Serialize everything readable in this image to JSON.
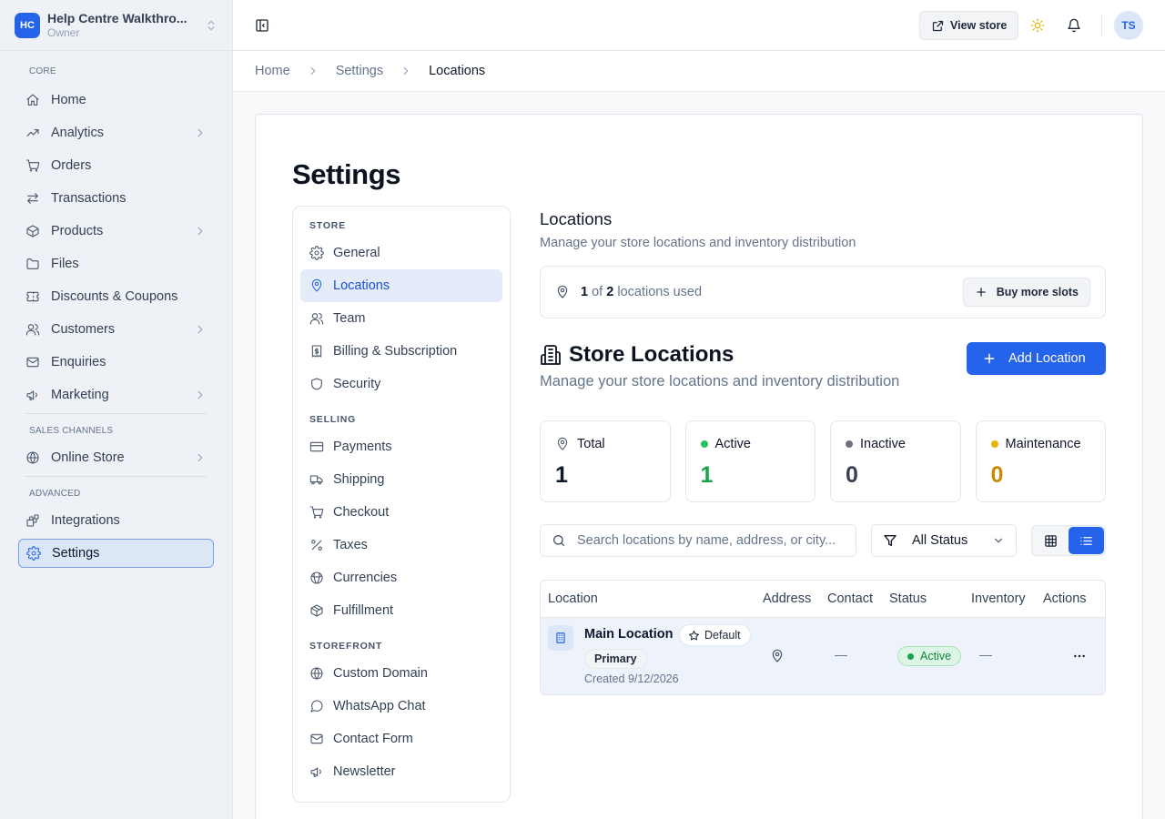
{
  "workspace": {
    "initials": "HC",
    "name": "Help Centre Walkthro...",
    "role": "Owner"
  },
  "sidebar": {
    "sections": [
      {
        "heading": "CORE",
        "items": [
          {
            "label": "Home",
            "icon": "home-icon",
            "chevron": false
          },
          {
            "label": "Analytics",
            "icon": "trending-up-icon",
            "chevron": true
          },
          {
            "label": "Orders",
            "icon": "cart-icon",
            "chevron": false
          },
          {
            "label": "Transactions",
            "icon": "arrows-exchange-icon",
            "chevron": false
          },
          {
            "label": "Products",
            "icon": "box-icon",
            "chevron": true
          },
          {
            "label": "Files",
            "icon": "folder-icon",
            "chevron": false
          },
          {
            "label": "Discounts & Coupons",
            "icon": "ticket-icon",
            "chevron": false
          },
          {
            "label": "Customers",
            "icon": "users-icon",
            "chevron": true
          },
          {
            "label": "Enquiries",
            "icon": "mail-icon",
            "chevron": false
          },
          {
            "label": "Marketing",
            "icon": "megaphone-icon",
            "chevron": true
          }
        ]
      },
      {
        "heading": "SALES CHANNELS",
        "items": [
          {
            "label": "Online Store",
            "icon": "globe-icon",
            "chevron": true
          }
        ]
      },
      {
        "heading": "ADVANCED",
        "items": [
          {
            "label": "Integrations",
            "icon": "blocks-icon",
            "chevron": false
          },
          {
            "label": "Settings",
            "icon": "gear-icon",
            "chevron": false,
            "active": true
          }
        ]
      }
    ]
  },
  "topbar": {
    "view_store": "View store",
    "avatar": "TS"
  },
  "breadcrumb": [
    "Home",
    "Settings",
    "Locations"
  ],
  "page_title": "Settings",
  "settings_nav": [
    {
      "heading": "STORE",
      "items": [
        {
          "label": "General",
          "icon": "gear-icon"
        },
        {
          "label": "Locations",
          "icon": "map-pin-icon",
          "active": true
        },
        {
          "label": "Team",
          "icon": "users-icon"
        },
        {
          "label": "Billing & Subscription",
          "icon": "receipt-icon"
        },
        {
          "label": "Security",
          "icon": "shield-icon"
        }
      ]
    },
    {
      "heading": "SELLING",
      "items": [
        {
          "label": "Payments",
          "icon": "credit-card-icon"
        },
        {
          "label": "Shipping",
          "icon": "truck-icon"
        },
        {
          "label": "Checkout",
          "icon": "cart-icon"
        },
        {
          "label": "Taxes",
          "icon": "percent-icon"
        },
        {
          "label": "Currencies",
          "icon": "coins-icon"
        },
        {
          "label": "Fulfillment",
          "icon": "package-icon"
        }
      ]
    },
    {
      "heading": "STOREFRONT",
      "items": [
        {
          "label": "Custom Domain",
          "icon": "globe-icon"
        },
        {
          "label": "WhatsApp Chat",
          "icon": "chat-icon"
        },
        {
          "label": "Contact Form",
          "icon": "mail-icon"
        },
        {
          "label": "Newsletter",
          "icon": "megaphone-icon"
        }
      ]
    }
  ],
  "locations": {
    "title": "Locations",
    "subtitle": "Manage your store locations and inventory distribution",
    "quota": {
      "used": "1",
      "of": "of",
      "total": "2",
      "suffix": "locations used",
      "buy_label": "Buy more slots"
    },
    "store_title": "Store Locations",
    "store_subtitle": "Manage your store locations and inventory distribution",
    "add_label": "Add Location",
    "stats": [
      {
        "label": "Total",
        "value": "1",
        "color": "#0f172a",
        "marker": "pin",
        "dot": ""
      },
      {
        "label": "Active",
        "value": "1",
        "color": "#16a34a",
        "marker": "dot",
        "dot": "#22c55e"
      },
      {
        "label": "Inactive",
        "value": "0",
        "color": "#374151",
        "marker": "dot",
        "dot": "#6b7280"
      },
      {
        "label": "Maintenance",
        "value": "0",
        "color": "#ca8a04",
        "marker": "dot",
        "dot": "#eab308"
      }
    ],
    "search_placeholder": "Search locations by name, address, or city...",
    "status_filter": "All Status",
    "table": {
      "columns": [
        "Location",
        "Address",
        "Contact",
        "Status",
        "Inventory",
        "Actions"
      ],
      "rows": [
        {
          "name": "Main Location",
          "default_badge": "Default",
          "primary_badge": "Primary",
          "created": "Created 9/12/2026",
          "contact": "—",
          "status": "Active",
          "inventory": "—"
        }
      ]
    }
  },
  "colors": {
    "accent": "#2563eb",
    "sidebar_bg": "#eef1f6",
    "active_status": "#16a34a",
    "maintenance": "#ca8a04"
  }
}
